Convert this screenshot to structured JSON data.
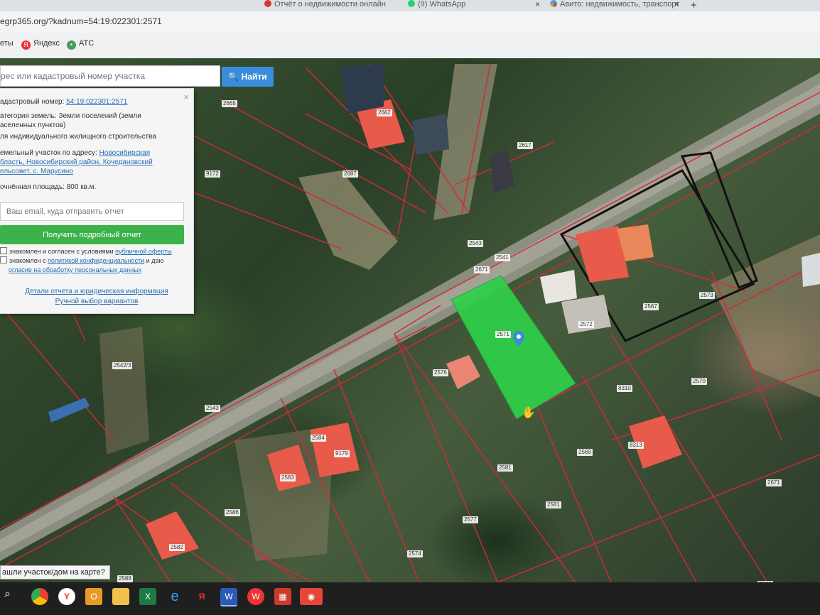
{
  "browser": {
    "tabs": [
      {
        "title": "Отчёт о недвижимости онлайн"
      },
      {
        "title": "(9) WhatsApp"
      },
      {
        "title": "Авито: недвижимость, транспорт"
      }
    ],
    "new_tab": "+",
    "close_glyph": "×",
    "url": "egrp365.org/?kadnum=54:19:022301:2571",
    "bookmarks": [
      {
        "label": "еты",
        "icon": "none"
      },
      {
        "label": "Яндекс",
        "icon": "yandex-icon",
        "glyph": "Я"
      },
      {
        "label": "АТС",
        "icon": "ats-icon",
        "glyph": "•"
      }
    ]
  },
  "search": {
    "placeholder": "рес или кадастровый номер участка",
    "button": "🔍 Найти"
  },
  "panel": {
    "close": "×",
    "cad_label": "адастровый номер: ",
    "cad_value": "54:19:022301:2571",
    "category_line1": "атегория земель: Земли поселений (земли",
    "category_line2": "аселенных пунктов)",
    "category_line3": "ля индивидуального жилищного строительства",
    "address_label": "емельный участок по адресу: ",
    "address_line1": "Новосибирская",
    "address_line2": "бласть, Новосибирский район, Кочедановский",
    "address_line3": "ельсовет, с. Марусино",
    "area": "очнённая площадь: 800 кв.м.",
    "email_placeholder": "Ваш email, куда отправить отчет",
    "get_report": "Получить подробный отчет",
    "consent1_text": "знакомлен и согласен с условиями ",
    "consent1_link": "публичной оферты",
    "consent2_text": "знакомлен с ",
    "consent2_link": "политикой конфиденциальности",
    "consent2_tail": " и даю",
    "consent2_line2": "огласие на обработку персональных данных",
    "details_link": "Детали отчета и юридическая информация",
    "manual_link": "Ручной выбор вариантов"
  },
  "map": {
    "labels": [
      {
        "text": "2665"
      },
      {
        "text": "2682"
      },
      {
        "text": "2617"
      },
      {
        "text": "2687"
      },
      {
        "text": "9172"
      },
      {
        "text": "2543"
      },
      {
        "text": "2541"
      },
      {
        "text": "2671"
      },
      {
        "text": "2571"
      },
      {
        "text": "2572"
      },
      {
        "text": "2567"
      },
      {
        "text": "2573"
      },
      {
        "text": "2576"
      },
      {
        "text": "2570"
      },
      {
        "text": "8310"
      },
      {
        "text": "8313"
      },
      {
        "text": "2569"
      },
      {
        "text": "2581"
      },
      {
        "text": "2584"
      },
      {
        "text": "9179"
      },
      {
        "text": "2583"
      },
      {
        "text": "2542/3"
      },
      {
        "text": "2543"
      },
      {
        "text": "2586"
      },
      {
        "text": "2582"
      },
      {
        "text": "2577"
      },
      {
        "text": "2574"
      },
      {
        "text": "2580"
      },
      {
        "text": "2588"
      },
      {
        "text": "2671"
      },
      {
        "text": "7196"
      },
      {
        "text": "2581"
      }
    ],
    "tooltip": "ашли участок/дом на карте?"
  },
  "colors": {
    "selected_parcel": "#2fd14a",
    "parcel_border": "#d8263a",
    "search_button": "#3a8ddc",
    "report_button": "#3cb24a",
    "roof_red": "#e85a4a"
  },
  "taskbar": {
    "items": [
      {
        "icon": "windows-search-icon"
      },
      {
        "icon": "chrome-icon"
      },
      {
        "icon": "yandex-browser-icon",
        "glyph": "Y"
      },
      {
        "icon": "outlook-icon",
        "glyph": "O"
      },
      {
        "icon": "file-explorer-icon"
      },
      {
        "icon": "excel-icon",
        "glyph": "X"
      },
      {
        "icon": "edge-icon",
        "glyph": "e"
      },
      {
        "icon": "yandex-icon",
        "glyph": "Я"
      },
      {
        "icon": "word-icon",
        "glyph": "W"
      },
      {
        "icon": "wps-icon",
        "glyph": "W"
      },
      {
        "icon": "app-icon",
        "glyph": "▦"
      },
      {
        "icon": "app-red-icon",
        "glyph": "◉"
      }
    ]
  }
}
